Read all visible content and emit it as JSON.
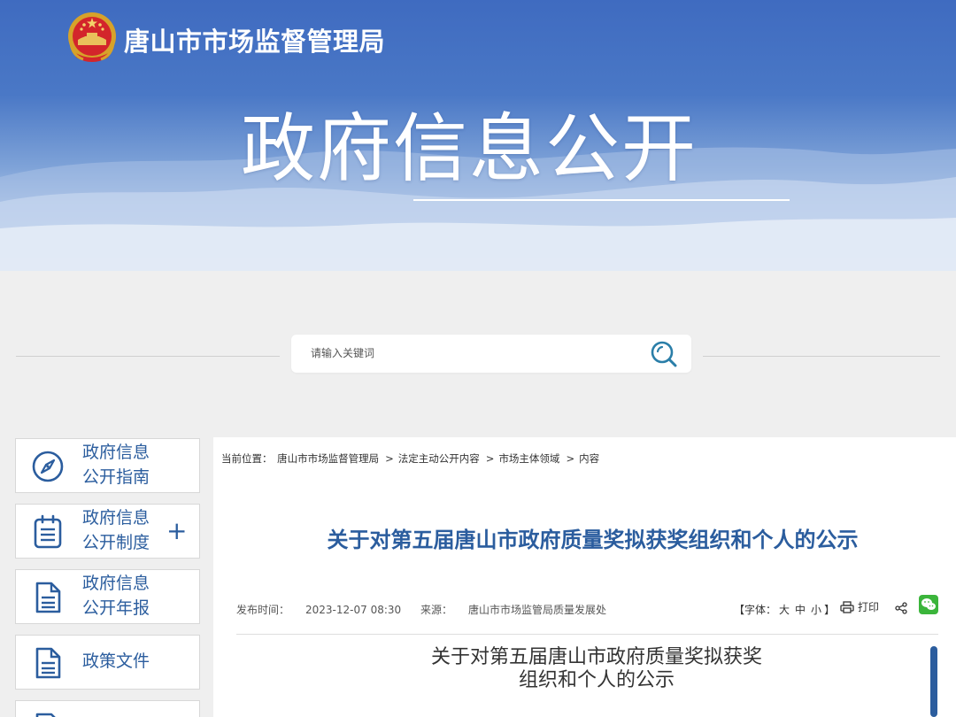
{
  "header": {
    "site_name": "唐山市市场监督管理局",
    "banner_title": "政府信息公开"
  },
  "search": {
    "placeholder": "请输入关键词"
  },
  "sidebar": {
    "items": [
      {
        "line1": "政府信息",
        "line2": "公开指南",
        "icon": "compass-icon"
      },
      {
        "line1": "政府信息",
        "line2": "公开制度",
        "icon": "clipboard-icon",
        "expand": "+"
      },
      {
        "line1": "政府信息",
        "line2": "公开年报",
        "icon": "document-icon"
      },
      {
        "line1": "政策文件",
        "icon": "document-icon"
      },
      {
        "icon": "document-icon"
      }
    ]
  },
  "breadcrumb": {
    "prefix": "当前位置：",
    "items": [
      "唐山市市场监督管理局",
      "法定主动公开内容",
      "市场主体领域",
      "内容"
    ],
    "separator": ">"
  },
  "article": {
    "title": "关于对第五届唐山市政府质量奖拟获奖组织和个人的公示",
    "publish_label": "发布时间：",
    "publish_time": "2023-12-07 08:30",
    "source_label": "来源：",
    "source": "唐山市市场监管局质量发展处",
    "font_label_open": "【字体：",
    "font_sizes": [
      "大",
      "中",
      "小"
    ],
    "font_label_close": "】",
    "print_label": "打印",
    "doc_title_line1": "关于对第五届唐山市政府质量奖拟获奖",
    "doc_title_line2": "组织和个人的公示"
  },
  "colors": {
    "accent": "#2b5d9e",
    "banner_blue": "#4a78c6",
    "wechat_green": "#3bb53b"
  }
}
